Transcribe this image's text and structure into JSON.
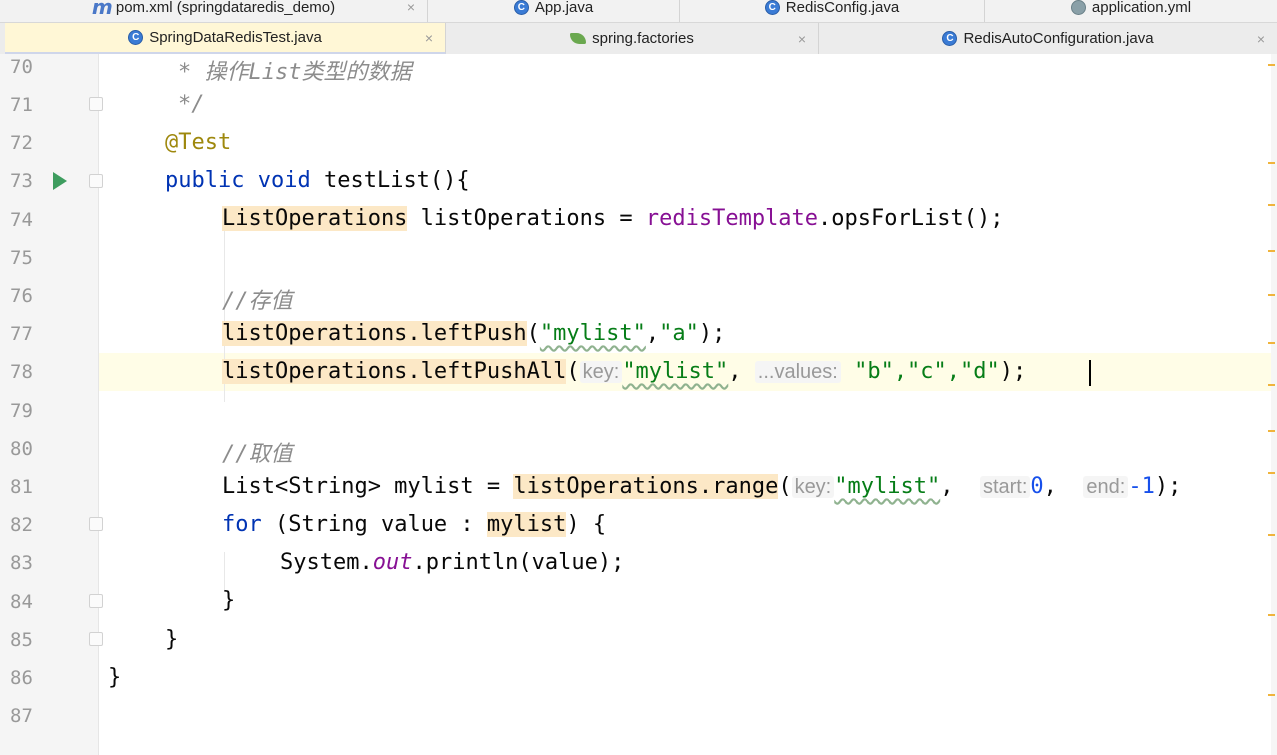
{
  "tabs_row1": [
    {
      "label": "pom.xml (springdataredis_demo)",
      "icon": "maven-icon"
    },
    {
      "label": "App.java",
      "icon": "java-class-icon"
    },
    {
      "label": "RedisConfig.java",
      "icon": "java-class-icon"
    },
    {
      "label": "application.yml",
      "icon": "yaml-gear-icon"
    }
  ],
  "tabs_row2": [
    {
      "label": "SpringDataRedisTest.java",
      "icon": "java-class-icon",
      "active": true
    },
    {
      "label": "spring.factories",
      "icon": "spring-leaf-icon"
    },
    {
      "label": "RedisAutoConfiguration.java",
      "icon": "java-class-icon"
    }
  ],
  "close_glyph": "×",
  "line_numbers": [
    "70",
    "71",
    "72",
    "73",
    "74",
    "75",
    "76",
    "77",
    "78",
    "79",
    "80",
    "81",
    "82",
    "83",
    "84",
    "85",
    "86",
    "87"
  ],
  "code": {
    "l70": "* 操作List类型的数据",
    "l71": "*/",
    "l72": "@Test",
    "l73_kw1": "public",
    "l73_kw2": "void",
    "l73_rest": "testList(){",
    "l74_type": "ListOperations",
    "l74_mid": " listOperations = ",
    "l74_field": "redisTemplate",
    "l74_end": ".opsForList();",
    "l76": "//存值",
    "l77_call": "listOperations.leftPush",
    "l77_open": "(",
    "l77_str1": "\"mylist\"",
    "l77_comma": ",",
    "l77_str2": "\"a\"",
    "l77_end": ");",
    "l78_call": "listOperations.leftPushAll",
    "l78_open": "(",
    "l78_hint1": "key:",
    "l78_str1": "\"mylist\"",
    "l78_comma": ", ",
    "l78_hint2": "...values:",
    "l78_args": "\"b\",\"c\",\"d\"",
    "l78_end": ");",
    "l80": "//取值",
    "l81_type": "List<String> mylist = ",
    "l81_call": "listOperations.range",
    "l81_open": "(",
    "l81_hint1": "key:",
    "l81_str1": "\"mylist\"",
    "l81_sep1": ",  ",
    "l81_hint2": "start:",
    "l81_num1": "0",
    "l81_sep2": ",  ",
    "l81_hint3": "end:",
    "l81_num2": "-1",
    "l81_end": ");",
    "l82_kw": "for",
    "l82_mid": " (String value : ",
    "l82_var": "mylist",
    "l82_end": ") {",
    "l83_a": "System.",
    "l83_out": "out",
    "l83_b": ".println(value);",
    "l84": "}",
    "l85": "}",
    "l86": "}"
  },
  "colors": {
    "keyword": "#0033b3",
    "annotation": "#9e880d",
    "string": "#067d17",
    "number": "#1750eb",
    "field": "#871094",
    "highlight": "#fce8c6"
  }
}
